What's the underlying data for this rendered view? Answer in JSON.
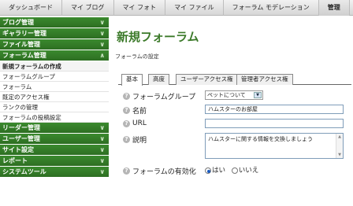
{
  "topnav": {
    "tabs": [
      "ダッシュボード",
      "マイ ブログ",
      "マイ フォト",
      "マイ ファイル",
      "フォーラム モデレーション",
      "管理"
    ],
    "active_index": 5
  },
  "sidebar": {
    "sections": [
      {
        "label": "ブログ管理",
        "icon": "chevron-down-icon"
      },
      {
        "label": "ギャラリー管理",
        "icon": "chevron-down-icon"
      },
      {
        "label": "ファイル管理",
        "icon": "chevron-down-icon"
      },
      {
        "label": "フォーラム管理",
        "icon": "chevron-up-icon"
      },
      {
        "label": "リーダー管理",
        "icon": "chevron-down-icon"
      },
      {
        "label": "ユーザー管理",
        "icon": "chevron-down-icon"
      },
      {
        "label": "サイト設定",
        "icon": "chevron-down-icon"
      },
      {
        "label": "レポート",
        "icon": "chevron-down-icon"
      },
      {
        "label": "システムツール",
        "icon": "chevron-down-icon"
      }
    ],
    "forum_items": [
      "新規フォーラムの作成",
      "フォーラムグループ",
      "フォーラム",
      "既定のアクセス権",
      "ランクの管理",
      "フォーラムの投稿設定"
    ],
    "active_item": "新規フォーラムの作成",
    "header_color": "#2d6e22"
  },
  "main": {
    "title": "新規フォーラム",
    "subtitle": "フォーラムの設定",
    "title_color": "#3c7a2a",
    "tabs": [
      "基本",
      "高度",
      "ユーザーアクセス権",
      "管理者アクセス権"
    ],
    "active_tab": "基本",
    "fields": {
      "group_label": "フォーラムグループ",
      "group_value": "ペットについて",
      "name_label": "名前",
      "name_value": "ハムスターのお部屋",
      "url_label": "URL",
      "url_value": "",
      "desc_label": "説明",
      "desc_value": "ハムスターに関する情報を交換しましょう",
      "enabled_label": "フォーラムの有効化",
      "yes_label": "はい",
      "no_label": "いいえ",
      "enabled_value": "はい"
    },
    "help_icon": "question-icon"
  }
}
